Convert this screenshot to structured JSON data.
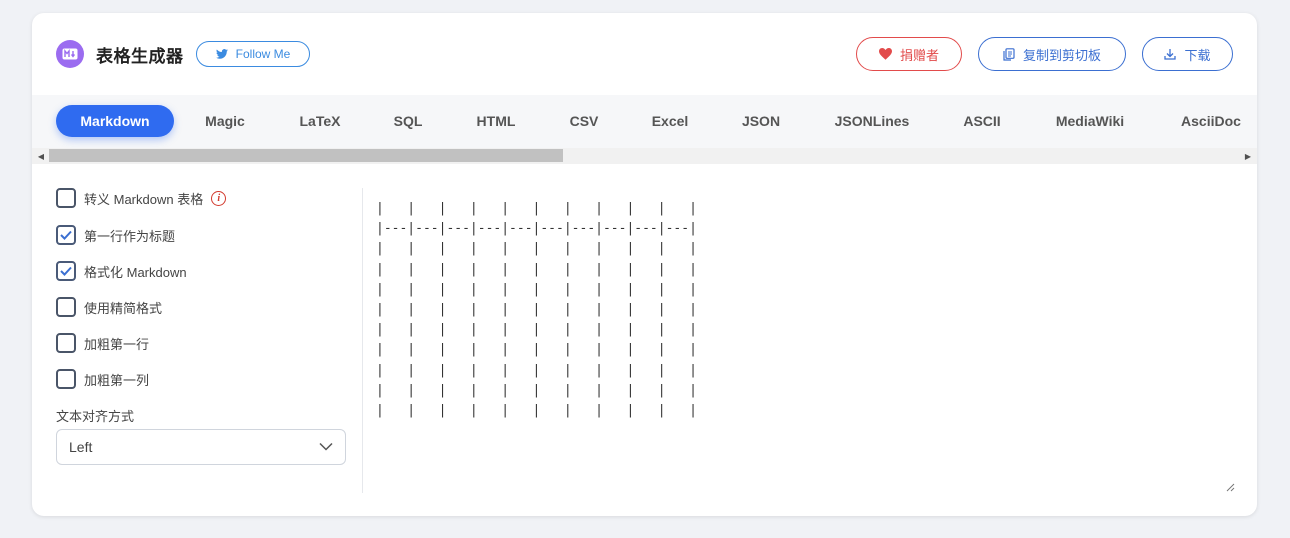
{
  "header": {
    "title": "表格生成器",
    "follow_label": "Follow Me",
    "donate_label": "捐赠者",
    "copy_label": "复制到剪切板",
    "download_label": "下载"
  },
  "tabs": [
    {
      "label": "Markdown",
      "active": true
    },
    {
      "label": "Magic"
    },
    {
      "label": "LaTeX"
    },
    {
      "label": "SQL"
    },
    {
      "label": "HTML"
    },
    {
      "label": "CSV"
    },
    {
      "label": "Excel"
    },
    {
      "label": "JSON"
    },
    {
      "label": "JSONLines"
    },
    {
      "label": "ASCII"
    },
    {
      "label": "MediaWiki"
    },
    {
      "label": "AsciiDoc"
    }
  ],
  "options": [
    {
      "label": "转义 Markdown 表格",
      "checked": false,
      "info": true
    },
    {
      "label": "第一行作为标题",
      "checked": true
    },
    {
      "label": "格式化 Markdown",
      "checked": true
    },
    {
      "label": "使用精简格式",
      "checked": false
    },
    {
      "label": "加粗第一行",
      "checked": false
    },
    {
      "label": "加粗第一列",
      "checked": false
    }
  ],
  "alignment": {
    "label": "文本对齐方式",
    "value": "Left"
  },
  "output": "|   |   |   |   |   |   |   |   |   |   |\n|---|---|---|---|---|---|---|---|---|---|\n|   |   |   |   |   |   |   |   |   |   |\n|   |   |   |   |   |   |   |   |   |   |\n|   |   |   |   |   |   |   |   |   |   |\n|   |   |   |   |   |   |   |   |   |   |\n|   |   |   |   |   |   |   |   |   |   |\n|   |   |   |   |   |   |   |   |   |   |\n|   |   |   |   |   |   |   |   |   |   |\n|   |   |   |   |   |   |   |   |   |   |\n|   |   |   |   |   |   |   |   |   |   |",
  "colors": {
    "accent": "#2f6bf0",
    "donate": "#e24b4b",
    "logo": "#9b6cf0"
  }
}
